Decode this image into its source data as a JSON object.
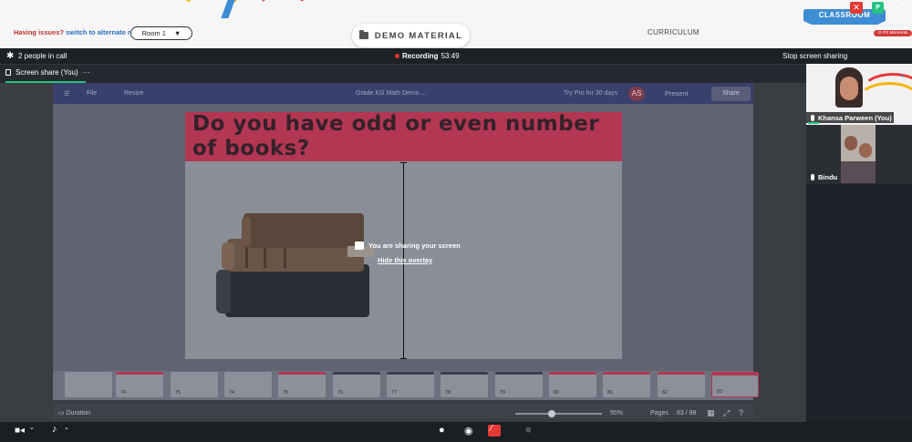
{
  "top_bar": {
    "issues_text": "Having issues?",
    "switch_link": "switch to alternate room",
    "room_select": "Room 1",
    "demo_material": "DEMO MATERIAL",
    "curriculum_tab": "CURRICULUM",
    "classroom_tab": "CLASSROOM",
    "ps_moments": "PS Moments",
    "colors": {
      "accent_blue": "#3d8dd4",
      "alert_red": "#c0312f"
    }
  },
  "call_bar": {
    "people_in_call": "2 people in call",
    "recording_label": "Recording",
    "recording_time": "53:49",
    "stop_sharing": "Stop screen sharing",
    "p_button": "P"
  },
  "tab_bar": {
    "tab_label": "Screen share (You)",
    "more": "···"
  },
  "shared_app": {
    "menu_file": "File",
    "menu_resize": "Resize",
    "doc_title": "Grade KG Math Demo ...",
    "try_pro": "Try Pro for 30 days",
    "avatar_initials": "AS",
    "present": "Present",
    "share": "Share",
    "slide_title": "Do you have odd or even number of books?",
    "overlay_message": "You are sharing your screen",
    "hide_overlay": "Hide this overlay",
    "duration": "Duration",
    "zoom": "55%",
    "pages_label": "Pages",
    "page_count": "83 / 88",
    "thumbnails": [
      {
        "num": "",
        "bar": "#8c909a"
      },
      {
        "num": "74",
        "bar": "#b33752"
      },
      {
        "num": "75",
        "bar": "#8c909a"
      },
      {
        "num": "74",
        "bar": "#8c909a"
      },
      {
        "num": "75",
        "bar": "#b33752"
      },
      {
        "num": "76",
        "bar": "#3a3d52"
      },
      {
        "num": "77",
        "bar": "#3a3d52"
      },
      {
        "num": "78",
        "bar": "#3a3d52"
      },
      {
        "num": "79",
        "bar": "#3a3d52"
      },
      {
        "num": "80",
        "bar": "#b33752"
      },
      {
        "num": "81",
        "bar": "#b33752"
      },
      {
        "num": "82",
        "bar": "#b33752"
      },
      {
        "num": "83",
        "bar": "#b33752"
      }
    ]
  },
  "participants": {
    "you": "Khansa Parween (You)",
    "other": "Bindu"
  }
}
